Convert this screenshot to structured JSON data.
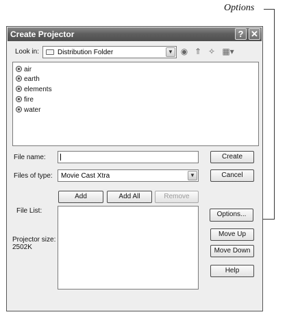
{
  "callout": {
    "label": "Options"
  },
  "dialog": {
    "title": "Create Projector",
    "help_glyph": "?",
    "close_glyph": "✕"
  },
  "look_in": {
    "label": "Look in:",
    "value": "Distribution Folder"
  },
  "toolbar_icons": [
    "back-icon",
    "up-folder-icon",
    "new-folder-icon",
    "view-menu-icon"
  ],
  "files": [
    {
      "name": "air"
    },
    {
      "name": "earth"
    },
    {
      "name": "elements"
    },
    {
      "name": "fire"
    },
    {
      "name": "water"
    }
  ],
  "file_name": {
    "label": "File name:",
    "value": ""
  },
  "file_type": {
    "label": "Files of type:",
    "value": "Movie Cast Xtra"
  },
  "buttons": {
    "create": "Create",
    "cancel": "Cancel",
    "add": "Add",
    "add_all": "Add All",
    "remove": "Remove",
    "options": "Options...",
    "move_up": "Move Up",
    "move_down": "Move Down",
    "help": "Help"
  },
  "file_list": {
    "label": "File List:"
  },
  "projector_size": {
    "label": "Projector size:",
    "value": "2502K"
  }
}
